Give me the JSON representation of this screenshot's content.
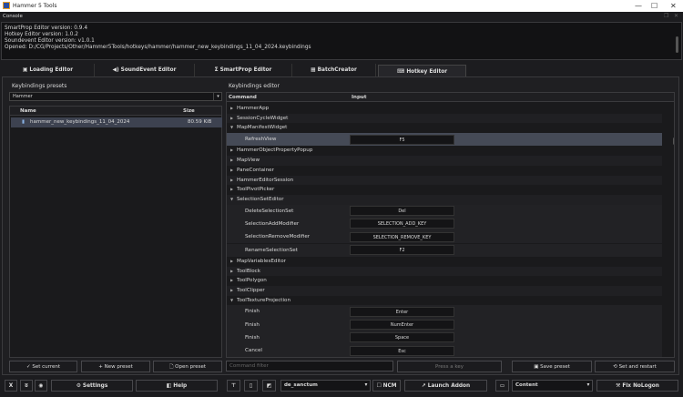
{
  "window": {
    "title": "Hammer 5 Tools",
    "minimize": "—",
    "maximize": "☐",
    "close": "✕"
  },
  "console": {
    "label": "Console",
    "lines": [
      "SmartProp Editor version: 0.9.4",
      "Hotkey Editor version: 1.0.2",
      "Soundevent Editor version: v1.0.1",
      "Opened: D:/CG/Projects/Other/Hammer5Tools/hotkeys/hammer/hammer_new_keybindings_11_04_2024.keybindings"
    ]
  },
  "tabs": [
    {
      "label": "Loading Editor",
      "icon": "image-icon"
    },
    {
      "label": "SoundEvent Editor",
      "icon": "speaker-icon"
    },
    {
      "label": "SmartProp Editor",
      "icon": "sigma-icon"
    },
    {
      "label": "BatchCreator",
      "icon": "grid-icon"
    },
    {
      "label": "Hotkey Editor",
      "icon": "keyboard-icon",
      "active": true
    }
  ],
  "presets": {
    "title": "Keybindings presets",
    "selected": "Hammer",
    "columns": [
      "Name",
      "Size"
    ],
    "files": [
      {
        "name": "hammer_new_keybindings_11_04_2024",
        "size": "80.59 KiB"
      }
    ],
    "set_current": "Set current",
    "new_preset": "New preset",
    "open_preset": "Open preset"
  },
  "editor": {
    "title": "Keybindings editor",
    "columns": [
      "Command",
      "Input"
    ],
    "rows": [
      {
        "type": "g",
        "label": "HammerApp",
        "open": false
      },
      {
        "type": "g",
        "label": "SessionCycleWidget",
        "open": false
      },
      {
        "type": "g",
        "label": "MapManifestWidget",
        "open": true
      },
      {
        "type": "c",
        "label": "RefreshView",
        "input": "F5",
        "selected": true
      },
      {
        "type": "g",
        "label": "HammerObjectPropertyPopup",
        "open": false
      },
      {
        "type": "g",
        "label": "MapView",
        "open": false
      },
      {
        "type": "g",
        "label": "PaneContainer",
        "open": false
      },
      {
        "type": "g",
        "label": "HammerEditorSession",
        "open": false
      },
      {
        "type": "g",
        "label": "ToolPivotPicker",
        "open": false
      },
      {
        "type": "g",
        "label": "SelectionSetEditor",
        "open": true
      },
      {
        "type": "c",
        "label": "DeleteSelectionSet",
        "input": "Del"
      },
      {
        "type": "c",
        "label": "SelectionAddModifier",
        "input": "SELECTION_ADD_KEY"
      },
      {
        "type": "c",
        "label": "SelectionRemoveModifier",
        "input": "SELECTION_REMOVE_KEY"
      },
      {
        "type": "c",
        "label": "RenameSelectionSet",
        "input": "F2"
      },
      {
        "type": "g",
        "label": "MapVariablesEditor",
        "open": false
      },
      {
        "type": "g",
        "label": "ToolBlock",
        "open": false
      },
      {
        "type": "g",
        "label": "ToolPolygon",
        "open": false
      },
      {
        "type": "g",
        "label": "ToolClipper",
        "open": false
      },
      {
        "type": "g",
        "label": "ToolTextureProjection",
        "open": true
      },
      {
        "type": "c",
        "label": "Finish",
        "input": "Enter"
      },
      {
        "type": "c",
        "label": "Finish",
        "input": "NumEnter"
      },
      {
        "type": "c",
        "label": "Finish",
        "input": "Space"
      },
      {
        "type": "c",
        "label": "Cancel",
        "input": "Esc"
      }
    ],
    "filter_placeholder": "Command filter",
    "press_key": "Press a key",
    "save_preset": "Save preset",
    "set_restart": "Set and restart"
  },
  "bottom": {
    "settings": "Settings",
    "help": "Help",
    "addon": "de_sanctum",
    "ncm": "NCM",
    "launch": "Launch Addon",
    "content": "Content",
    "fix": "Fix NoLogon"
  }
}
